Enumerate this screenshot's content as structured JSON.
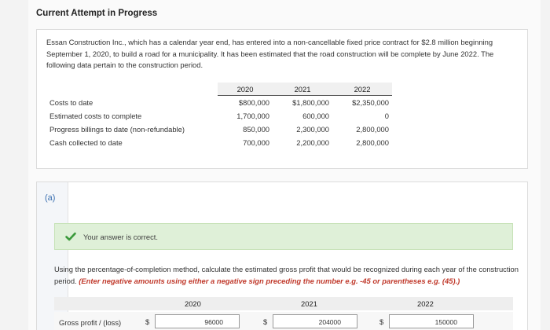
{
  "header": {
    "title": "Current Attempt in Progress"
  },
  "problem": {
    "text": "Essan Construction Inc., which has a calendar year end, has entered into a non-cancellable fixed price contract for $2.8 million beginning September 1, 2020, to build a road for a municipality. It has been estimated that the road construction will be complete by June 2022. The following data pertain to the construction period.",
    "table": {
      "years": [
        "2020",
        "2021",
        "2022"
      ],
      "rows": [
        {
          "label": "Costs to date",
          "values": [
            "$800,000",
            "$1,800,000",
            "$2,350,000"
          ]
        },
        {
          "label": "Estimated costs to complete",
          "values": [
            "1,700,000",
            "600,000",
            "0"
          ]
        },
        {
          "label": "Progress billings to date (non-refundable)",
          "values": [
            "850,000",
            "2,300,000",
            "2,800,000"
          ]
        },
        {
          "label": "Cash collected to date",
          "values": [
            "700,000",
            "2,200,000",
            "2,800,000"
          ]
        }
      ]
    }
  },
  "part_a": {
    "label": "(a)",
    "feedback": "Your answer is correct.",
    "instructions": "Using the percentage-of-completion method, calculate the estimated gross profit that would be recognized during each year of the construction period.",
    "hint": "(Enter negative amounts using either a negative sign preceding the number e.g. -45 or parentheses e.g. (45).)",
    "answer_table": {
      "years": [
        "2020",
        "2021",
        "2022"
      ],
      "row_label": "Gross profit / (loss)",
      "currency": "$",
      "values": [
        "96000",
        "204000",
        "150000"
      ]
    }
  },
  "colors": {
    "success_bg": "#dff0d8",
    "success_check": "#3c9a3c",
    "hint": "#c0392b",
    "part_label": "#3a6fb0"
  }
}
